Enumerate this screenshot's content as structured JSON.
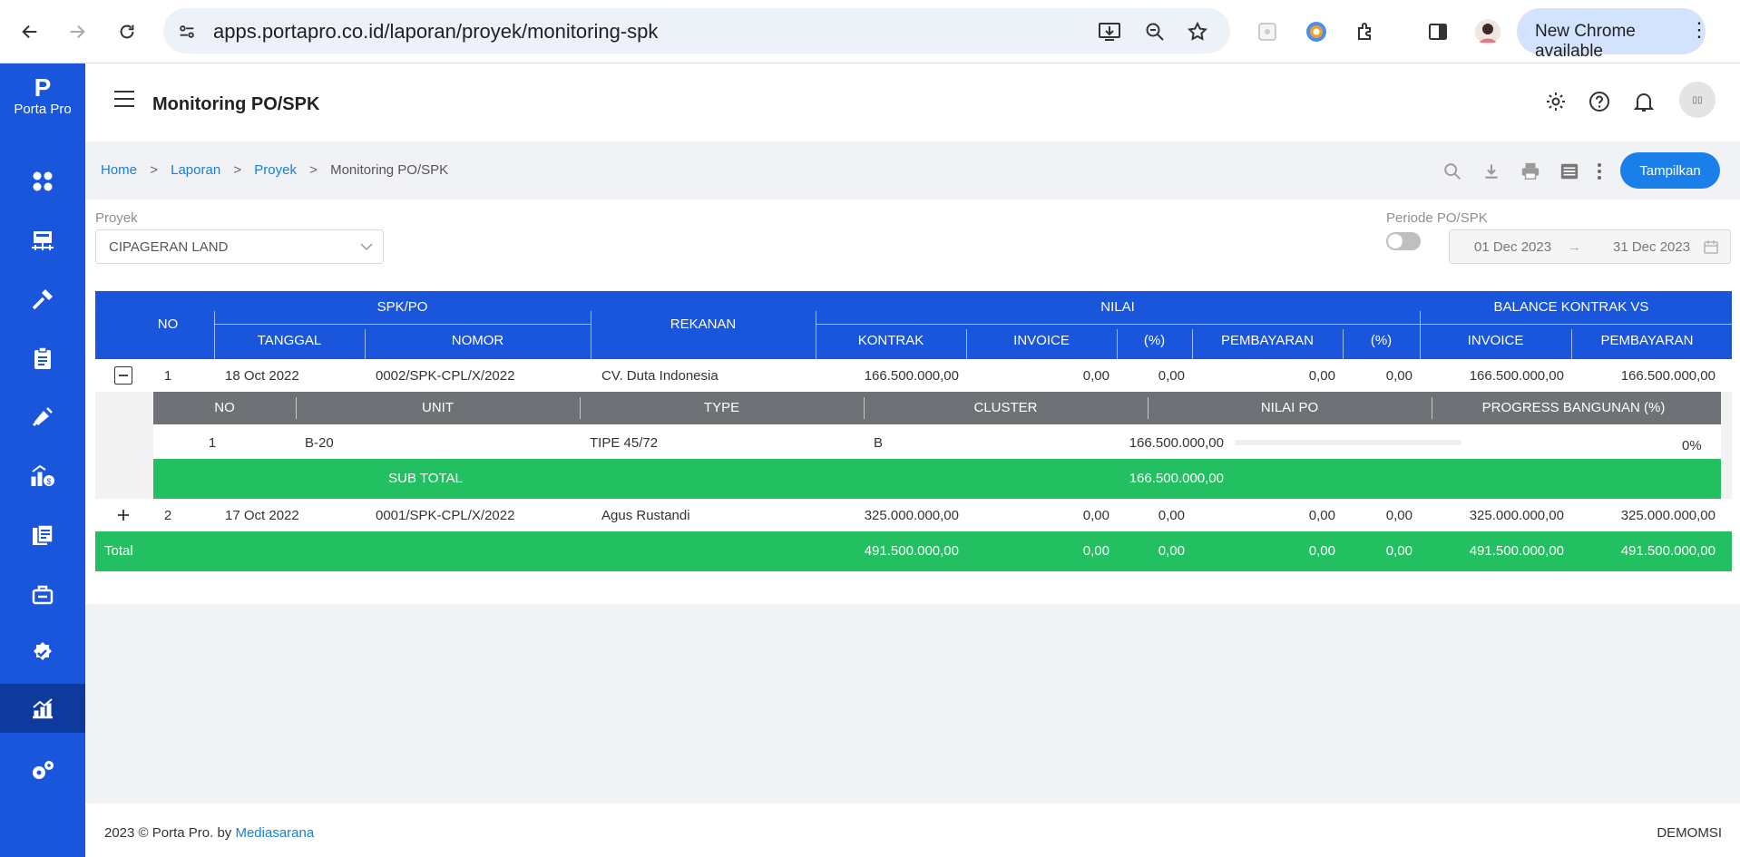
{
  "browser": {
    "url": "apps.portapro.co.id/laporan/proyek/monitoring-spk",
    "update_label": "New Chrome available"
  },
  "sidebar": {
    "logo_mark": "P",
    "logo_text": "Porta Pro",
    "items": [
      {
        "icon": "dashboard-icon"
      },
      {
        "icon": "project-icon"
      },
      {
        "icon": "tools-icon"
      },
      {
        "icon": "clipboard-icon"
      },
      {
        "icon": "marketing-icon"
      },
      {
        "icon": "finance-growth-icon"
      },
      {
        "icon": "billing-icon"
      },
      {
        "icon": "handover-icon"
      },
      {
        "icon": "approval-icon"
      },
      {
        "icon": "report-chart-icon",
        "active": true
      },
      {
        "icon": "settings-gears-icon"
      }
    ]
  },
  "header": {
    "title": "Monitoring PO/SPK",
    "avatar_text": "▯▯"
  },
  "breadcrumb": {
    "items": [
      "Home",
      "Laporan",
      "Proyek"
    ],
    "current": "Monitoring PO/SPK",
    "separator": ">"
  },
  "toolbar": {
    "show_label": "Tampilkan"
  },
  "filters": {
    "project_label": "Proyek",
    "project_value": "CIPAGERAN LAND",
    "period_label": "Periode PO/SPK",
    "date_from": "01 Dec 2023",
    "date_to": "31 Dec 2023",
    "date_arrow": "→"
  },
  "table": {
    "headers": {
      "no": "NO",
      "spk_po": "SPK/PO",
      "tanggal": "TANGGAL",
      "nomor": "NOMOR",
      "rekanan": "REKANAN",
      "nilai": "NILAI",
      "kontrak": "KONTRAK",
      "invoice": "INVOICE",
      "pct1": "(%)",
      "pembayaran": "PEMBAYARAN",
      "pct2": "(%)",
      "balance": "BALANCE KONTRAK VS",
      "bal_invoice": "INVOICE",
      "bal_pembayaran": "PEMBAYARAN"
    },
    "rows": [
      {
        "expander": "−",
        "no": "1",
        "tanggal": "18 Oct 2022",
        "nomor": "0002/SPK-CPL/X/2022",
        "rekanan": "CV. Duta Indonesia",
        "kontrak": "166.500.000,00",
        "invoice": "0,00",
        "pct1": "0,00",
        "pembayaran": "0,00",
        "pct2": "0,00",
        "bal_invoice": "166.500.000,00",
        "bal_pembayaran": "166.500.000,00"
      },
      {
        "expander": "+",
        "no": "2",
        "tanggal": "17 Oct 2022",
        "nomor": "0001/SPK-CPL/X/2022",
        "rekanan": "Agus Rustandi",
        "kontrak": "325.000.000,00",
        "invoice": "0,00",
        "pct1": "0,00",
        "pembayaran": "0,00",
        "pct2": "0,00",
        "bal_invoice": "325.000.000,00",
        "bal_pembayaran": "325.000.000,00"
      }
    ],
    "detail": {
      "headers": {
        "no": "NO",
        "unit": "UNIT",
        "type": "TYPE",
        "cluster": "CLUSTER",
        "nilai_po": "NILAI PO",
        "progress": "PROGRESS BANGUNAN (%)"
      },
      "row": {
        "no": "1",
        "unit": "B-20",
        "type": "TIPE 45/72",
        "cluster": "B",
        "nilai_po": "166.500.000,00",
        "progress_label": "0%",
        "progress_value": 0
      },
      "subtotal_label": "SUB TOTAL",
      "subtotal_value": "166.500.000,00"
    },
    "total": {
      "label": "Total",
      "kontrak": "491.500.000,00",
      "invoice": "0,00",
      "pct1": "0,00",
      "pembayaran": "0,00",
      "pct2": "0,00",
      "bal_invoice": "491.500.000,00",
      "bal_pembayaran": "491.500.000,00"
    }
  },
  "footer": {
    "copyright": "2023 © Porta Pro. by",
    "vendor": "Mediasarana",
    "user": "DEMOMSI"
  },
  "colors": {
    "primary": "#1a56db",
    "accent_button": "#1a7fe8",
    "success": "#22c061",
    "subheader": "#6e7276"
  }
}
